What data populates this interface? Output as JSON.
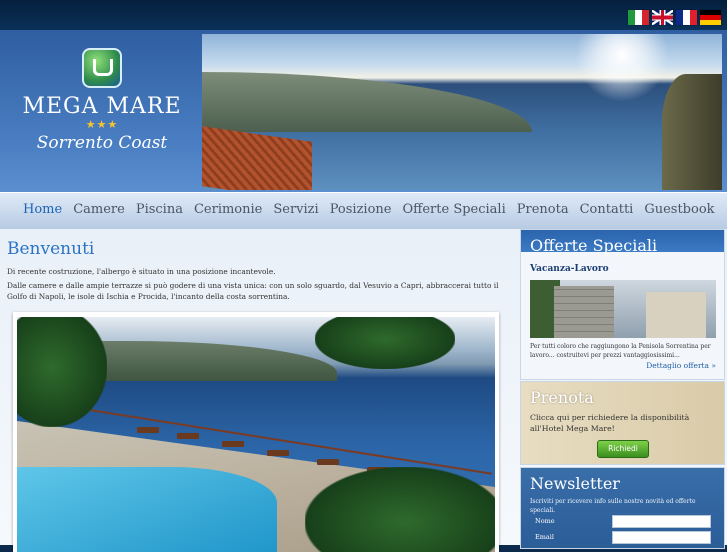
{
  "languages": [
    {
      "code": "it",
      "icon": "italian-flag-icon"
    },
    {
      "code": "en",
      "icon": "uk-flag-icon"
    },
    {
      "code": "fr",
      "icon": "french-flag-icon"
    },
    {
      "code": "de",
      "icon": "german-flag-icon"
    }
  ],
  "logo": {
    "name": "MEGA MARE",
    "stars": "★★★",
    "tagline": "Sorrento Coast"
  },
  "nav": {
    "items": [
      "Home",
      "Camere",
      "Piscina",
      "Cerimonie",
      "Servizi",
      "Posizione",
      "Offerte Speciali",
      "Prenota",
      "Contatti",
      "Guestbook"
    ],
    "active": "Home"
  },
  "main": {
    "title": "Benvenuti",
    "paragraph1": "Di recente costruzione, l'albergo è situato in una posizione incantevole.",
    "paragraph2": "Dalle camere e dalle ampie terrazze si può godere di una vista unica: con un solo sguardo, dal Vesuvio a Capri, abbraccerai tutto il Golfo di Napoli, le isole di Ischia e Procida, l'incanto della costa sorrentina."
  },
  "offerte": {
    "heading": "Offerte Speciali",
    "offer_title": "Vacanza-Lavoro",
    "offer_text": "Per tutti coloro che raggiungono la Penisola Sorrentina per lavoro... costruitevi per prezzi vantaggiosissimi...",
    "more_label": "Dettaglio offerta »"
  },
  "prenota": {
    "heading": "Prenota",
    "text": "Clicca qui per richiedere la disponibilità all'Hotel Mega Mare!",
    "button_label": "Richiedi"
  },
  "newsletter": {
    "heading": "Newsletter",
    "text": "Iscriviti per ricevere info sulle nostre novità ed offerte speciali.",
    "name_label": "Nome",
    "email_label": "Email"
  },
  "colors": {
    "brand_blue": "#2a73c4",
    "nav_active": "#1d64b6",
    "header_bg": "#2f5ea1",
    "button_green": "#3a8f1e"
  }
}
